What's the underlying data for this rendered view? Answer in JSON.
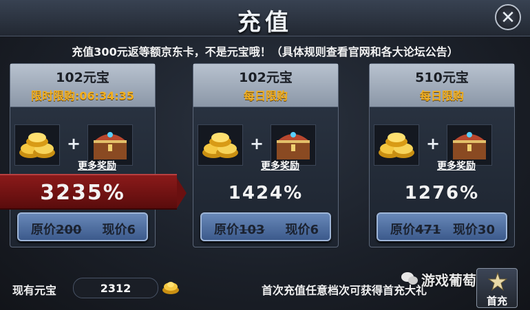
{
  "window": {
    "title": "充值"
  },
  "notice": "充值300元返等额京东卡，不是元宝哦！（具体规则查看官网和各大论坛公告）",
  "more_rewards_label": "更多奖励",
  "cards": [
    {
      "name": "102元宝",
      "subtitle": "限时限购:06:34:35",
      "percent": "3235%",
      "orig_prefix": "原价",
      "orig_value": "200",
      "now_label": "现价6",
      "ribbon": true
    },
    {
      "name": "102元宝",
      "subtitle": "每日限购",
      "percent": "1424%",
      "orig_prefix": "原价",
      "orig_value": "103",
      "now_label": "现价6",
      "ribbon": false
    },
    {
      "name": "510元宝",
      "subtitle": "每日限购",
      "percent": "1276%",
      "orig_prefix": "原价",
      "orig_value": "471",
      "now_label": "现价30",
      "ribbon": false
    }
  ],
  "footer": {
    "have_label": "现有元宝",
    "have_value": "2312",
    "first_text": "首次充值任意档次可获得首充大礼",
    "first_button": "首充"
  },
  "watermark": "游戏葡萄",
  "colors": {
    "subtitle": "#f4b020",
    "ribbon": "#8b1a1a",
    "button": "#4f6fa2"
  }
}
